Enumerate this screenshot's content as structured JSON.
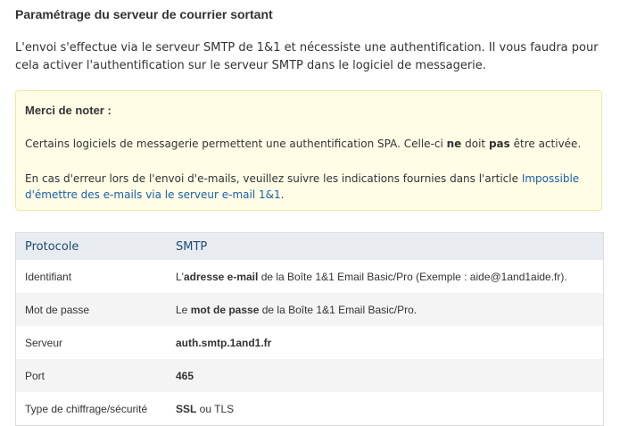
{
  "title": "Paramétrage du serveur de courrier sortant",
  "intro": "L'envoi s'effectue via le serveur SMTP de 1&1 et nécessiste une authentification. Il vous faudra pour cela activer l'authentification sur le serveur SMTP dans le logiciel de messagerie.",
  "note": {
    "title": "Merci de noter :",
    "p1_a": "Certains logiciels de messagerie permettent une authentification SPA. Celle-ci ",
    "p1_b": "ne",
    "p1_c": " doit ",
    "p1_d": "pas",
    "p1_e": " être activée.",
    "p2_a": "En cas d'erreur lors de l'envoi d'e-mails, veuillez suivre les indications fournies dans l'article ",
    "p2_link": "Impossible d'émettre des e-mails via le serveur e-mail 1&1",
    "p2_b": "."
  },
  "table": {
    "head": {
      "c1": "Protocole",
      "c2": "SMTP"
    },
    "rows": [
      {
        "c1": "Identifiant",
        "pre": "L'",
        "bold": "adresse e-mail",
        "post": " de la Boîte 1&1 Email Basic/Pro (Exemple : aide@1and1aide.fr)."
      },
      {
        "c1": "Mot de passe",
        "pre": "Le ",
        "bold": "mot de passe",
        "post": " de la Boîte 1&1 Email Basic/Pro."
      },
      {
        "c1": "Serveur",
        "pre": "",
        "bold": "auth.smtp.1and1.fr",
        "post": ""
      },
      {
        "c1": "Port",
        "pre": "",
        "bold": "465",
        "post": ""
      },
      {
        "c1": "Type de chiffrage/sécurité",
        "pre": "",
        "bold": "SSL",
        "post": " ou TLS"
      }
    ]
  }
}
